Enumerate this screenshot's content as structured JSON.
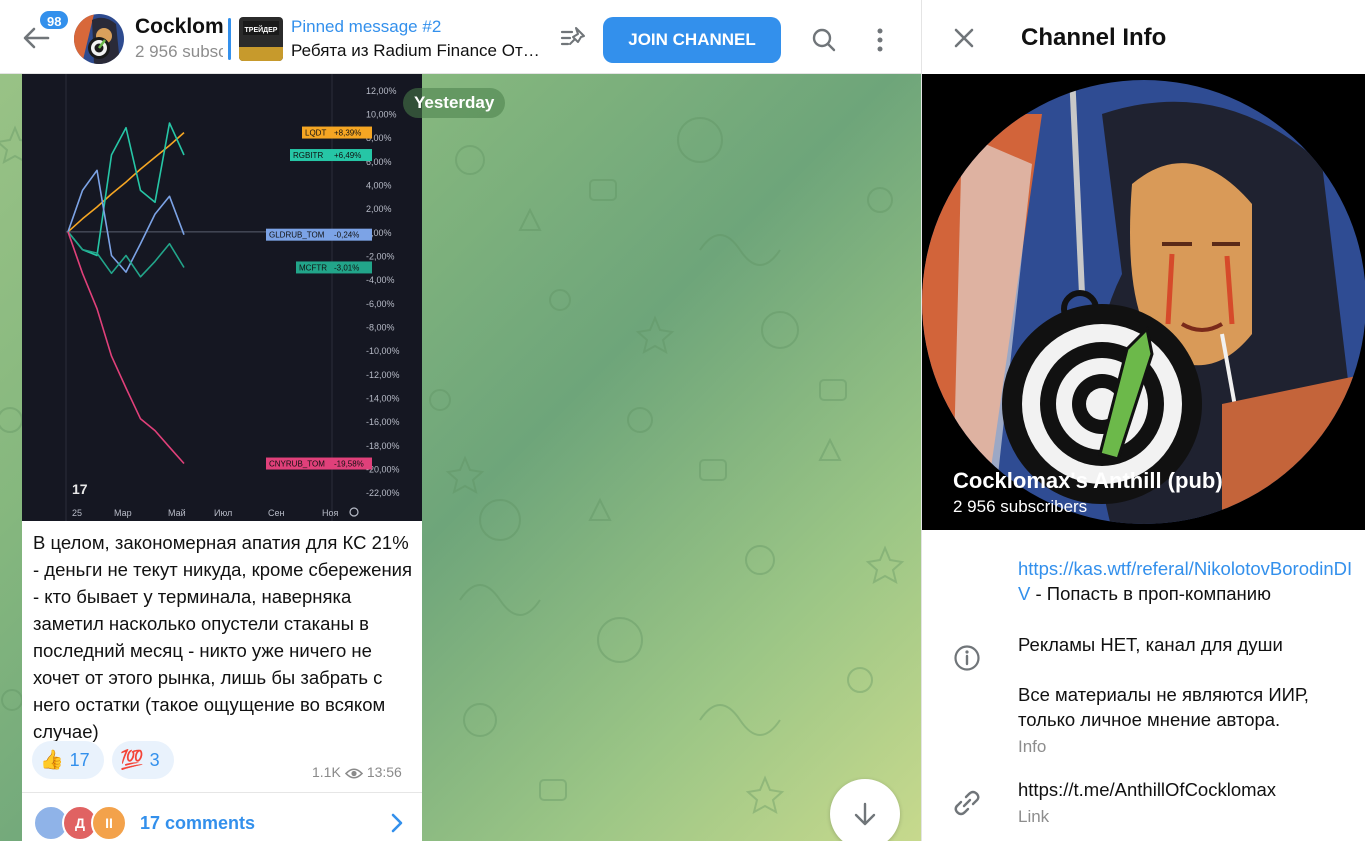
{
  "chat": {
    "unread_count": "98",
    "title": "Cocklomax's Anthill (pub)",
    "subtitle": "2 956 subscribers",
    "pinned_title": "Pinned message #2",
    "pinned_text": "Ребята из Radium Finance Открыли",
    "pinned_thumb_text": "ТРЕЙДЕР",
    "join_label": "JOIN CHANNEL",
    "date_divider": "Yesterday"
  },
  "message": {
    "text": "В целом, закономерная апатия для КС 21% - деньги не текут никуда, кроме сбережения - кто бывает у терминала, наверняка заметил насколько опустели стаканы в последний месяц - никто уже ничего не хочет от этого рынка, лишь бы забрать с него остатки (такое ощущение во всяком случае)",
    "reactions": [
      {
        "emoji": "👍",
        "count": "17"
      },
      {
        "emoji": "💯",
        "count": "3"
      }
    ],
    "views": "1.1K",
    "time": "13:56",
    "comments_label": "17 comments",
    "commenter_initials": [
      "",
      "Д",
      "II"
    ]
  },
  "chart_data": {
    "type": "line",
    "x_ticks": [
      "25",
      "Мар",
      "Май",
      "Июл",
      "Сен",
      "Ноя"
    ],
    "y_ticks": [
      "12,00%",
      "10,00%",
      "8,00%",
      "6,00%",
      "4,00%",
      "2,00%",
      "0,00%",
      "-2,00%",
      "-4,00%",
      "-6,00%",
      "-8,00%",
      "-10,00%",
      "-12,00%",
      "-14,00%",
      "-16,00%",
      "-18,00%",
      "-20,00%",
      "-22,00%"
    ],
    "ylim": [
      -23,
      13
    ],
    "series": [
      {
        "name": "LQDT",
        "label": "+8,39%",
        "color": "#f5a623",
        "values": [
          0,
          1.1,
          2.1,
          3.2,
          4.2,
          5.3,
          6.3,
          7.3,
          8.39
        ]
      },
      {
        "name": "RGBITR",
        "label": "+6,49%",
        "color": "#26c6a6",
        "values": [
          0,
          -1.5,
          -2.0,
          6.5,
          8.8,
          3.5,
          2.5,
          9.2,
          6.49
        ]
      },
      {
        "name": "GLDRUB_TOM",
        "label": "-0,24%",
        "color": "#7ca3e6",
        "values": [
          0,
          3.5,
          5.2,
          -2.0,
          -3.4,
          -1.0,
          1.5,
          3.0,
          -0.24
        ]
      },
      {
        "name": "MCFTR",
        "label": "-3,01%",
        "color": "#22a58a",
        "values": [
          0,
          -1.5,
          -1.8,
          -3.5,
          -2.0,
          -3.8,
          -2.5,
          -1.0,
          -3.01
        ]
      },
      {
        "name": "CNYRUB_TOM",
        "label": "-19,58%",
        "color": "#e0407a",
        "values": [
          0,
          -3.5,
          -6.5,
          -10.5,
          -13.2,
          -15.8,
          -16.8,
          -18.2,
          -19.58
        ]
      }
    ]
  },
  "info": {
    "title": "Channel Info",
    "channel_name": "Cocklomax's Anthill (pub)",
    "subscribers": "2 956 subscribers",
    "referral_link": "https://kas.wtf/referal/NikolotovBorodinDIV",
    "referral_suffix": " - Попасть в проп-компанию",
    "description_1": "Рекламы НЕТ, канал для души",
    "description_2": "Все материалы не являются ИИР, только личное мнение автора.",
    "description_label": "Info",
    "channel_link": "https://t.me/AnthillOfCocklomax",
    "link_label": "Link"
  },
  "colors": {
    "accent": "#3390ec",
    "chat_bg": "#86b77e",
    "chart_bg": "#151722"
  },
  "icons": [
    "back-arrow-icon",
    "pinned-list-icon",
    "search-icon",
    "more-vertical-icon",
    "eye-icon",
    "chevron-right-icon",
    "arrow-down-icon",
    "close-icon",
    "info-icon",
    "link-icon"
  ]
}
